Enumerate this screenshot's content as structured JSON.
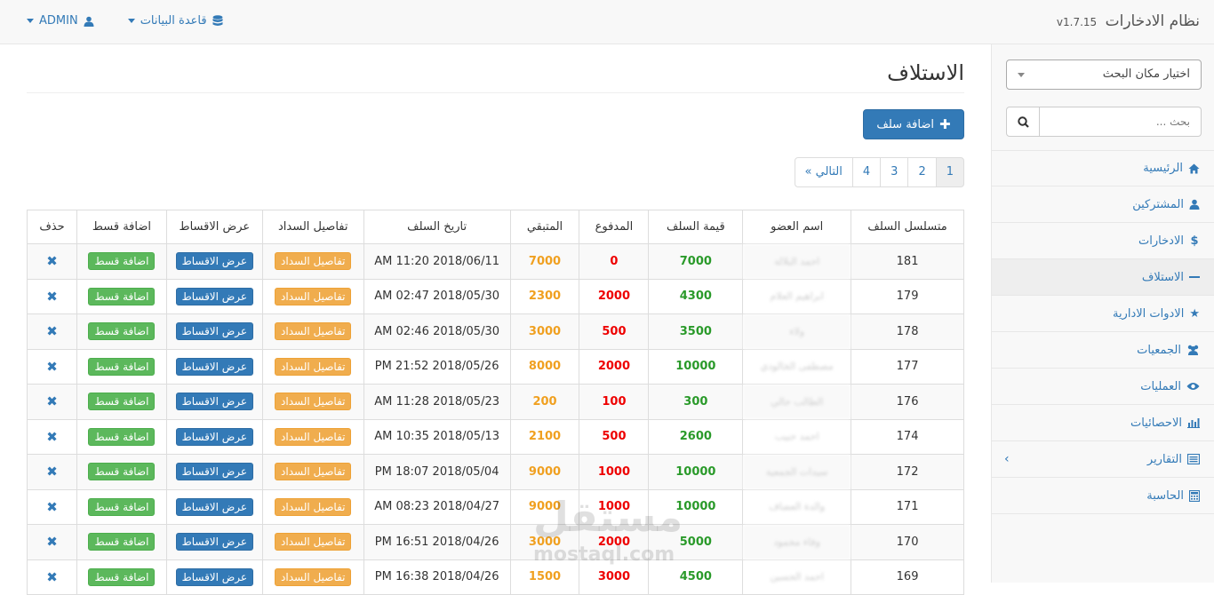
{
  "header": {
    "brand": "نظام الادخارات",
    "version": "v1.7.15",
    "database_label": "قاعدة البيانات",
    "user_label": "ADMIN"
  },
  "sidebar": {
    "select_placeholder": "اختيار مكان البحث",
    "search_placeholder": "بحث ...",
    "items": [
      {
        "label": "الرئيسية",
        "icon": "home-icon"
      },
      {
        "label": "المشتركين",
        "icon": "user-icon"
      },
      {
        "label": "الادخارات",
        "icon": "dollar-icon"
      },
      {
        "label": "الاستلاف",
        "icon": "minus-icon"
      },
      {
        "label": "الادوات الادارية",
        "icon": "star-icon"
      },
      {
        "label": "الجمعيات",
        "icon": "users-icon"
      },
      {
        "label": "العمليات",
        "icon": "eye-icon"
      },
      {
        "label": "الاحصائيات",
        "icon": "bar-chart-icon"
      },
      {
        "label": "التقارير",
        "icon": "list-icon"
      },
      {
        "label": "الحاسبة",
        "icon": "calculator-icon"
      }
    ]
  },
  "main": {
    "title": "الاستلاف",
    "add_button": "اضافة سلف",
    "pagination": [
      "1",
      "2",
      "3",
      "4",
      "التالي »"
    ],
    "columns": [
      "متسلسل السلف",
      "اسم العضو",
      "قيمة السلف",
      "المدفوع",
      "المتبقي",
      "تاريخ السلف",
      "تفاصيل السداد",
      "عرض الاقساط",
      "اضافة قسط",
      "حذف"
    ],
    "action_labels": {
      "details": "تفاصيل السداد",
      "installments": "عرض الاقساط",
      "add": "اضافة قسط",
      "delete": "✖"
    },
    "rows": [
      {
        "id": "181",
        "name": "احمد البلالة",
        "value": "7000",
        "paid": "0",
        "remaining": "7000",
        "date": "AM 11:20 2018/06/11"
      },
      {
        "id": "179",
        "name": "ابراهيم العلام",
        "value": "4300",
        "paid": "2000",
        "remaining": "2300",
        "date": "AM 02:47 2018/05/30"
      },
      {
        "id": "178",
        "name": "ولاء",
        "value": "3500",
        "paid": "500",
        "remaining": "3000",
        "date": "AM 02:46 2018/05/30"
      },
      {
        "id": "177",
        "name": "مصطفى الخالودي",
        "value": "10000",
        "paid": "2000",
        "remaining": "8000",
        "date": "PM 21:52 2018/05/26"
      },
      {
        "id": "176",
        "name": "الطالب حالي",
        "value": "300",
        "paid": "100",
        "remaining": "200",
        "date": "AM 11:28 2018/05/23"
      },
      {
        "id": "174",
        "name": "احمد حبيب",
        "value": "2600",
        "paid": "500",
        "remaining": "2100",
        "date": "AM 10:35 2018/05/13"
      },
      {
        "id": "172",
        "name": "سيدات الجمعية",
        "value": "10000",
        "paid": "1000",
        "remaining": "9000",
        "date": "PM 18:07 2018/05/04"
      },
      {
        "id": "171",
        "name": "والدة العضاف",
        "value": "10000",
        "paid": "1000",
        "remaining": "9000",
        "date": "AM 08:23 2018/04/27"
      },
      {
        "id": "170",
        "name": "وفاء محمود",
        "value": "5000",
        "paid": "2000",
        "remaining": "3000",
        "date": "PM 16:51 2018/04/26"
      },
      {
        "id": "169",
        "name": "احمد الحسين",
        "value": "4500",
        "paid": "3000",
        "remaining": "1500",
        "date": "PM 16:38 2018/04/26"
      }
    ]
  },
  "watermark": {
    "arabic": "مستقل",
    "latin": "mostaql.com"
  }
}
